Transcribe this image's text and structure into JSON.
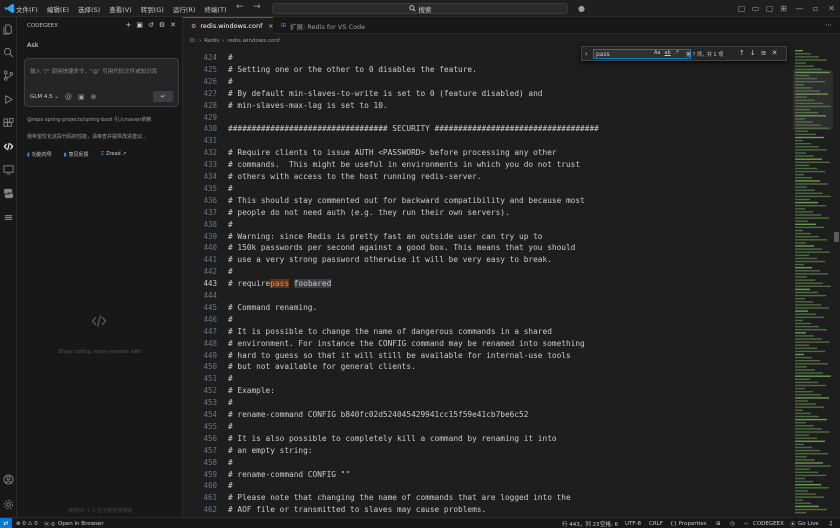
{
  "titlebar": {
    "menus": [
      "文件(F)",
      "编辑(E)",
      "选择(S)",
      "查看(V)",
      "转到(G)",
      "运行(R)",
      "终端(T)"
    ],
    "command_center": "搜索",
    "back": "←",
    "forward": "→"
  },
  "sidebar": {
    "header": "CODEGEEX",
    "ask_label": "Ask",
    "input_placeholder": "输入 \"/\" 调用快捷命令，\"@\" 引用代码文件或知识库",
    "model": "GLM 4.5",
    "send": "↵",
    "hint_1": "@repo spring-projects/spring-boot 引入maven依赖",
    "hint_2": "我希望优化这段代码的性能，请审查并提供改进建议...",
    "links": [
      {
        "label": "功能向导",
        "icon": "book-icon"
      },
      {
        "label": "意见反馈",
        "icon": "feedback-icon"
      },
      {
        "label": "Zread",
        "icon": "zread-icon"
      }
    ],
    "empty_text": "Enjoy coding, enjoy smarter with",
    "footer_hint": "使用Alt + S 显示键盘快捷键"
  },
  "tabs": [
    {
      "label": "redis.windows.conf",
      "active": true,
      "close": "×"
    },
    {
      "label": "扩展: Redis for VS Code",
      "active": false,
      "close": ""
    }
  ],
  "breadcrumb": [
    "D:",
    "Redis",
    "redis.windows.conf"
  ],
  "find": {
    "value": "pass",
    "case": "Aa",
    "word": "ab",
    "regex": ".*",
    "count": "第 ? 项，共 1 项"
  },
  "editor": {
    "current_line": "443",
    "lines": [
      {
        "n": "424",
        "t": "#"
      },
      {
        "n": "425",
        "t": "# Setting one or the other to 0 disables the feature."
      },
      {
        "n": "426",
        "t": "#"
      },
      {
        "n": "427",
        "t": "# By default min-slaves-to-write is set to 0 (feature disabled) and"
      },
      {
        "n": "428",
        "t": "# min-slaves-max-lag is set to 10."
      },
      {
        "n": "429",
        "t": ""
      },
      {
        "n": "430",
        "t": "################################## SECURITY ###################################"
      },
      {
        "n": "431",
        "t": ""
      },
      {
        "n": "432",
        "t": "# Require clients to issue AUTH <PASSWORD> before processing any other"
      },
      {
        "n": "433",
        "t": "# commands.  This might be useful in environments in which you do not trust"
      },
      {
        "n": "434",
        "t": "# others with access to the host running redis-server."
      },
      {
        "n": "435",
        "t": "#"
      },
      {
        "n": "436",
        "t": "# This should stay commented out for backward compatibility and because most"
      },
      {
        "n": "437",
        "t": "# people do not need auth (e.g. they run their own servers)."
      },
      {
        "n": "438",
        "t": "#"
      },
      {
        "n": "439",
        "t": "# Warning: since Redis is pretty fast an outside user can try up to"
      },
      {
        "n": "440",
        "t": "# 150k passwords per second against a good box. This means that you should"
      },
      {
        "n": "441",
        "t": "# use a very strong password otherwise it will be very easy to break."
      },
      {
        "n": "442",
        "t": "#"
      },
      {
        "n": "443",
        "t": "# require",
        "match": "pass",
        "rest_sp": " ",
        "rest": "foobared"
      },
      {
        "n": "444",
        "t": ""
      },
      {
        "n": "445",
        "t": "# Command renaming."
      },
      {
        "n": "446",
        "t": "#"
      },
      {
        "n": "447",
        "t": "# It is possible to change the name of dangerous commands in a shared"
      },
      {
        "n": "448",
        "t": "# environment. For instance the CONFIG command may be renamed into something"
      },
      {
        "n": "449",
        "t": "# hard to guess so that it will still be available for internal-use tools"
      },
      {
        "n": "450",
        "t": "# but not available for general clients."
      },
      {
        "n": "451",
        "t": "#"
      },
      {
        "n": "452",
        "t": "# Example:"
      },
      {
        "n": "453",
        "t": "#"
      },
      {
        "n": "454",
        "t": "# rename-command CONFIG b840fc02d524045429941cc15f59e41cb7be6c52"
      },
      {
        "n": "455",
        "t": "#"
      },
      {
        "n": "456",
        "t": "# It is also possible to completely kill a command by renaming it into"
      },
      {
        "n": "457",
        "t": "# an empty string:"
      },
      {
        "n": "458",
        "t": "#"
      },
      {
        "n": "459",
        "t": "# rename-command CONFIG \"\""
      },
      {
        "n": "460",
        "t": "#"
      },
      {
        "n": "461",
        "t": "# Please note that changing the name of commands that are logged into the"
      },
      {
        "n": "462",
        "t": "# AOF file or transmitted to slaves may cause problems."
      }
    ]
  },
  "statusbar": {
    "problems": "⊗ 0 ⚠ 0",
    "ports": "ⓦ 0",
    "open_browser": "Open In Browser",
    "position": "行 443，列 23",
    "spaces": "空格: 6",
    "encoding": "UTF-8",
    "eol": "CRLF",
    "language": "{} Properties",
    "codegeex": "CODEGEEX",
    "golive": "Go Live"
  },
  "colors": {
    "accent": "#0078d4",
    "match_bg": "#613214",
    "editor_bg": "#1e1e1e"
  }
}
